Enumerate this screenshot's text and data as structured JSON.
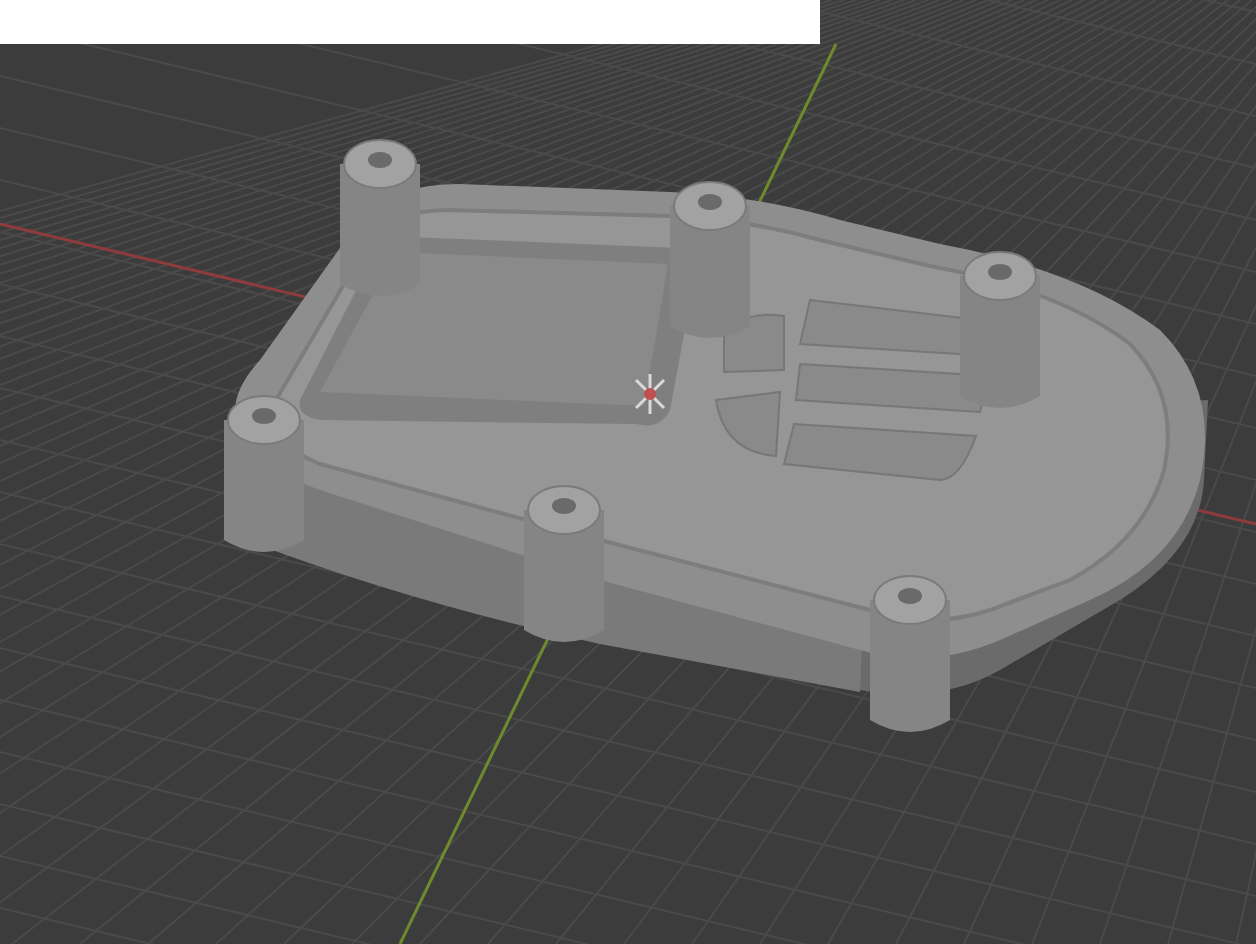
{
  "viewport": {
    "grid": true,
    "axes": [
      {
        "kind": "x",
        "color": "#8e3b3b"
      },
      {
        "kind": "y",
        "color": "#6e8a2c"
      }
    ]
  }
}
